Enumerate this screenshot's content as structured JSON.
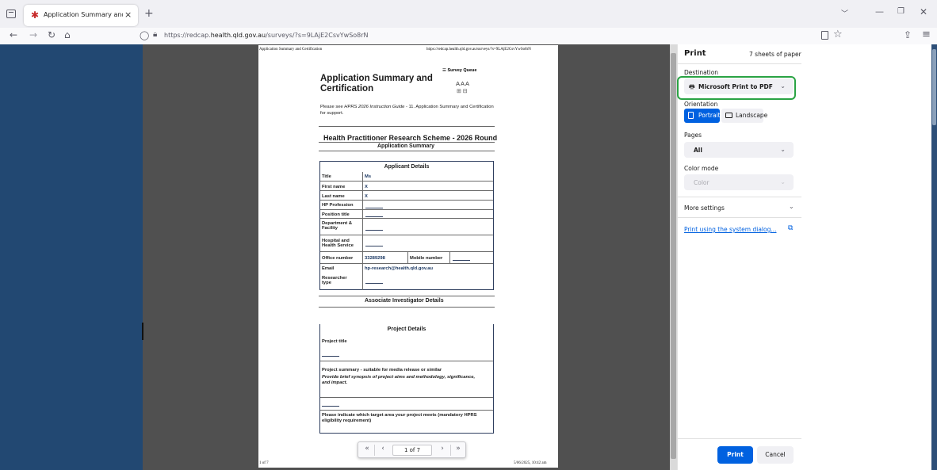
{
  "browser": {
    "tab_title": "Application Summary and Certif",
    "tab_close": "×",
    "new_tab": "+",
    "url_prefix": "https://redcap.",
    "url_domain": "health.qld.gov.au",
    "url_path": "/surveys/?s=9LAjE2CsvYwSo8rN"
  },
  "sheet": {
    "header_left": "Application Summary and Certification",
    "header_right": "https://redcap.health.qld.gov.au/surveys/?s=9LAjE2CsvYwSo8rN",
    "footer_left": "1 of 7",
    "footer_right": "5/06/2025, 10:42 am",
    "survey_queue": "Survey Queue",
    "text_size": "AAA",
    "title": "Application Summary and Certification",
    "intro_a": "Please see ",
    "intro_guide": "HPRS 2026 Instruction Guide",
    "intro_b": " - 11. Application Summary and Certification for support.",
    "round_title": "Health Practitioner Research Scheme - 2026 Round",
    "section_summary": "Application Summary",
    "applicant_header": "Applicant Details",
    "fields": {
      "title_label": "Title",
      "title_value": "Ms",
      "first_label": "First name",
      "first_value": "X",
      "last_label": "Last name",
      "last_value": "X",
      "profession_label": "HP Profession",
      "position_label": "Position title",
      "department_label": "Department & Facility",
      "hospital_label": "Hospital and Health Service",
      "office_label": "Office number",
      "office_value": "33289298",
      "mobile_label": "Mobile number",
      "email_label": "Email",
      "email_value": "hp-research@health.qld.gov.au",
      "researcher_label": "Researcher type"
    },
    "associate_header": "Associate Investigator Details",
    "project_header": "Project Details",
    "project_title_label": "Project title",
    "summary_label": "Project summary - suitable for media release or similar",
    "summary_hint": "Provide brief synopsis of project aims and methodology, significance, and impact.",
    "target_label": "Please indicate which target area your project meets (mandatory HPRS eligibility requirement)"
  },
  "pager": {
    "page": "1 of 7"
  },
  "print_panel": {
    "title": "Print",
    "sheets": "7 sheets of paper",
    "destination_label": "Destination",
    "destination_value": "Microsoft Print to PDF",
    "orientation_label": "Orientation",
    "portrait": "Portrait",
    "landscape": "Landscape",
    "pages_label": "Pages",
    "pages_value": "All",
    "color_label": "Color mode",
    "color_value": "Color",
    "more_settings": "More settings",
    "system_dialog": "Print using the system dialog...",
    "print_button": "Print",
    "cancel_button": "Cancel",
    "accent_color": "#0061e0",
    "focus_ring_color": "#2aa344"
  }
}
